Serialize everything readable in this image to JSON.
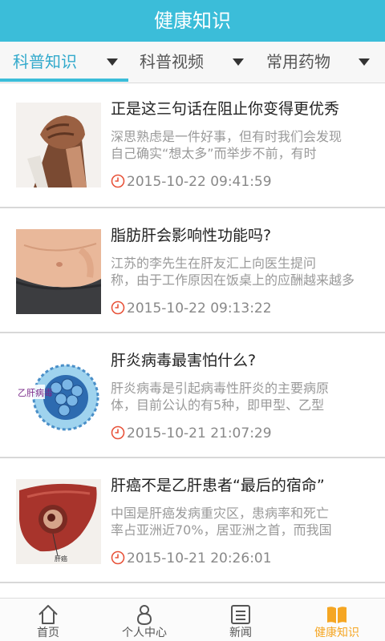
{
  "header": {
    "title": "健康知识"
  },
  "tabs": [
    {
      "label": "科普知识",
      "active": true
    },
    {
      "label": "科普视频",
      "active": false
    },
    {
      "label": "常用药物",
      "active": false
    }
  ],
  "articles": [
    {
      "title": "正是这三句话在阻止你变得更优秀",
      "desc1": "深思熟虑是一件好事，但有时我们会发现",
      "desc2": "自己确实“想太多”而举步不前，有时",
      "time": "2015-10-22 09:41:59",
      "image": "handshake-image"
    },
    {
      "title": "脂肪肝会影响性功能吗?",
      "desc1": "江苏的李先生在肝友汇上向医生提问",
      "desc2": "称，由于工作原因在饭桌上的应酬越来越多",
      "time": "2015-10-22 09:13:22",
      "image": "belly-image"
    },
    {
      "title": "肝炎病毒最害怕什么?",
      "desc1": "肝炎病毒是引起病毒性肝炎的主要病原",
      "desc2": "体，目前公认的有5种，即甲型、乙型",
      "time": "2015-10-21 21:07:29",
      "image": "virus-image",
      "image_text": "乙肝病毒"
    },
    {
      "title": "肝癌不是乙肝患者“最后的宿命”",
      "desc1": "中国是肝癌发病重灾区，患病率和死亡",
      "desc2": "率占亚洲近70%，居亚洲之首，而我国",
      "time": "2015-10-21 20:26:01",
      "image": "liver-image",
      "image_text": "肝癌"
    }
  ],
  "bottom_nav": [
    {
      "label": "首页",
      "icon": "home-icon",
      "active": false
    },
    {
      "label": "个人中心",
      "icon": "person-icon",
      "active": false
    },
    {
      "label": "新闻",
      "icon": "news-icon",
      "active": false
    },
    {
      "label": "健康知识",
      "icon": "book-icon",
      "active": true
    }
  ],
  "colors": {
    "header": "#3bbdd9",
    "active_tab": "#33aacc",
    "active_nav": "#f5a623",
    "clock": "#e8533a"
  }
}
